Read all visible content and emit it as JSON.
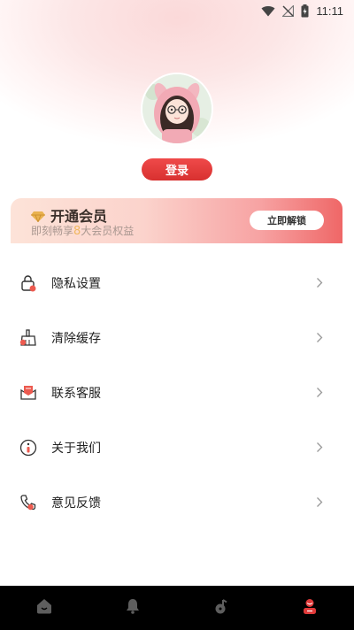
{
  "status_bar": {
    "time": "11:11",
    "icons": [
      "wifi-icon",
      "no-signal-icon",
      "battery-icon"
    ]
  },
  "profile": {
    "avatar": "avatar-girl-bunny-hood",
    "login_label": "登录"
  },
  "vip": {
    "title": "开通会员",
    "subtitle_prefix": "即刻畅享",
    "subtitle_number": "8",
    "subtitle_suffix": "大会员权益",
    "unlock_label": "立即解锁",
    "icon": "diamond-icon"
  },
  "menu": {
    "items": [
      {
        "label": "隐私设置",
        "icon": "lock-icon"
      },
      {
        "label": "清除缓存",
        "icon": "broom-icon"
      },
      {
        "label": "联系客服",
        "icon": "mail-icon"
      },
      {
        "label": "关于我们",
        "icon": "info-icon"
      },
      {
        "label": "意见反馈",
        "icon": "phone-icon"
      }
    ]
  },
  "tabbar": {
    "tabs": [
      {
        "icon": "home-icon",
        "active": false
      },
      {
        "icon": "bell-icon",
        "active": false
      },
      {
        "icon": "music-icon",
        "active": false
      },
      {
        "icon": "profile-icon",
        "active": true
      }
    ]
  },
  "colors": {
    "accent": "#e03a3a",
    "vip_number": "#f0b860",
    "tabbar_bg": "#000000",
    "tab_inactive": "#666666"
  }
}
